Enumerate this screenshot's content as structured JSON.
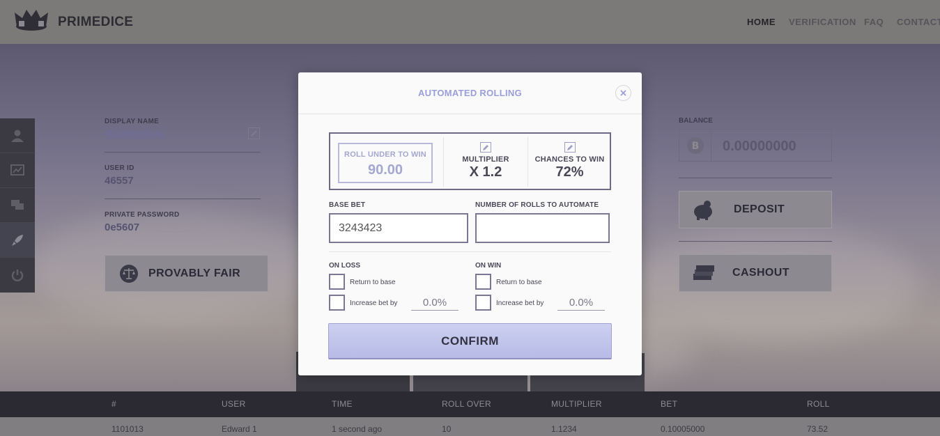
{
  "header": {
    "brand": "PRIMEDICE",
    "nav": [
      {
        "label": "HOME"
      },
      {
        "label": "VERIFICATION"
      },
      {
        "label": "FAQ"
      },
      {
        "label": "CONTACT"
      }
    ]
  },
  "profile": {
    "display_name_label": "DISPLAY NAME",
    "display_name": "Akabmikua",
    "user_id_label": "USER ID",
    "user_id": "46557",
    "password_label": "PRIVATE PASSWORD",
    "password": "0e5607",
    "provably_fair_label": "PROVABLY FAIR"
  },
  "wallet": {
    "balance_label": "BALANCE",
    "balance": "0.00000000",
    "deposit_label": "DEPOSIT",
    "cashout_label": "CASHOUT"
  },
  "table": {
    "headers": [
      "#",
      "USER",
      "TIME",
      "ROLL OVER",
      "MULTIPLIER",
      "BET",
      "ROLL"
    ],
    "rows": [
      [
        "1101013",
        "Edward 1",
        "1 second ago",
        "10",
        "1.1234",
        "0.10005000",
        "73.52"
      ]
    ]
  },
  "modal": {
    "title": "AUTOMATED ROLLING",
    "roll_under_label": "ROLL UNDER TO WIN",
    "roll_under_value": "90.00",
    "multiplier_label": "MULTIPLIER",
    "multiplier_value": "X 1.2",
    "chance_label": "CHANCES TO WIN",
    "chance_value": "72%",
    "base_bet_label": "BASE BET",
    "base_bet_value": "3243423",
    "rolls_label": "NUMBER OF ROLLS TO AUTOMATE",
    "rolls_value": "",
    "on_loss": {
      "title": "ON LOSS",
      "return_label": "Return to base",
      "increase_label": "Increase bet by",
      "increase_value": "0.0%"
    },
    "on_win": {
      "title": "ON WIN",
      "return_label": "Return to base",
      "increase_label": "Increase bet by",
      "increase_value": "0.0%"
    },
    "confirm_label": "CONFIRM"
  }
}
